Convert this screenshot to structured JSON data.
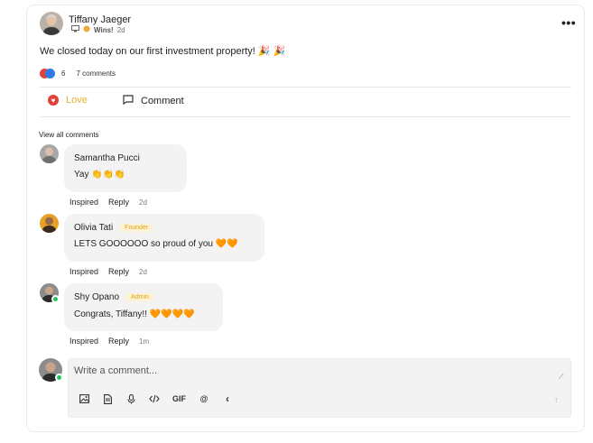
{
  "post": {
    "author": "Tiffany Jaeger",
    "category": "Wins!",
    "time": "2d",
    "text": "We closed today on our first investment property! 🎉 🎉",
    "reaction_count": "6",
    "comments_count": "7 comments",
    "more_icon": "•••"
  },
  "actions": {
    "love_label": "Love",
    "comment_label": "Comment"
  },
  "comments_section": {
    "view_all": "View all comments",
    "items": [
      {
        "name": "Samantha Pucci",
        "badge": "",
        "text": "Yay 👏👏👏",
        "like_label": "Inspired",
        "reply_label": "Reply",
        "time": "2d"
      },
      {
        "name": "Olivia Tati",
        "badge": "Founder",
        "text": "LETS GOOOOOO so proud of you 🧡🧡",
        "like_label": "Inspired",
        "reply_label": "Reply",
        "time": "2d"
      },
      {
        "name": "Shy Opano",
        "badge": "Admin",
        "text": "Congrats, Tiffany!! 🧡🧡🧡🧡",
        "like_label": "Inspired",
        "reply_label": "Reply",
        "time": "1m"
      }
    ]
  },
  "composer": {
    "placeholder": "Write a comment...",
    "gif_label": "GIF",
    "mention_label": "@",
    "collapse_label": "‹"
  },
  "colors": {
    "love": "#e8b12d",
    "badge_bg": "#fdf3d3",
    "badge_text": "#e0a51a",
    "online": "#22c55e"
  }
}
